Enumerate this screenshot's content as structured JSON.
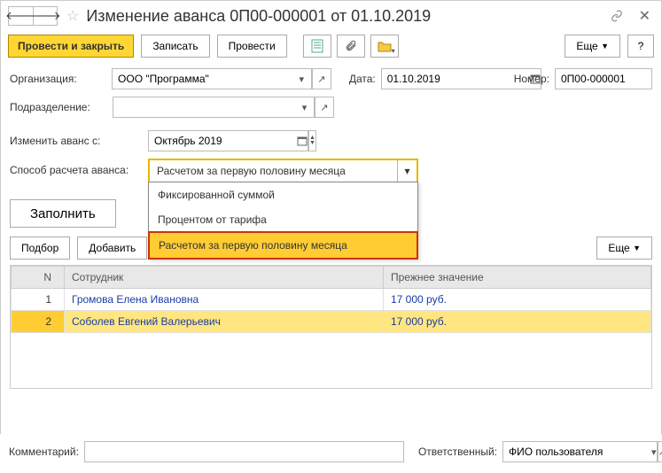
{
  "header": {
    "title": "Изменение аванса 0П00-000001 от 01.10.2019"
  },
  "toolbar": {
    "post_and_close": "Провести и закрыть",
    "save": "Записать",
    "post": "Провести",
    "more": "Еще",
    "help": "?"
  },
  "fields": {
    "org_label": "Организация:",
    "org_value": "ООО \"Программа\"",
    "date_label": "Дата:",
    "date_value": "01.10.2019",
    "number_label": "Номер:",
    "number_value": "0П00-000001",
    "dept_label": "Подразделение:",
    "dept_value": "",
    "change_from_label": "Изменить аванс с:",
    "change_from_value": "Октябрь 2019",
    "calc_method_label": "Способ расчета аванса:",
    "calc_method_value": "Расчетом за первую половину месяца",
    "calc_options": [
      "Фиксированной суммой",
      "Процентом от тарифа",
      "Расчетом за первую половину месяца"
    ]
  },
  "actions": {
    "fill": "Заполнить",
    "pick": "Подбор",
    "add": "Добавить",
    "more": "Еще"
  },
  "table": {
    "headers": {
      "n": "N",
      "employee": "Сотрудник",
      "prev": "Прежнее значение"
    },
    "rows": [
      {
        "n": "1",
        "employee": "Громова Елена Ивановна",
        "prev": "17 000 руб."
      },
      {
        "n": "2",
        "employee": "Соболев Евгений Валерьевич",
        "prev": "17 000 руб."
      }
    ]
  },
  "footer": {
    "comment_label": "Комментарий:",
    "comment_value": "",
    "responsible_label": "Ответственный:",
    "responsible_value": "ФИО пользователя"
  }
}
